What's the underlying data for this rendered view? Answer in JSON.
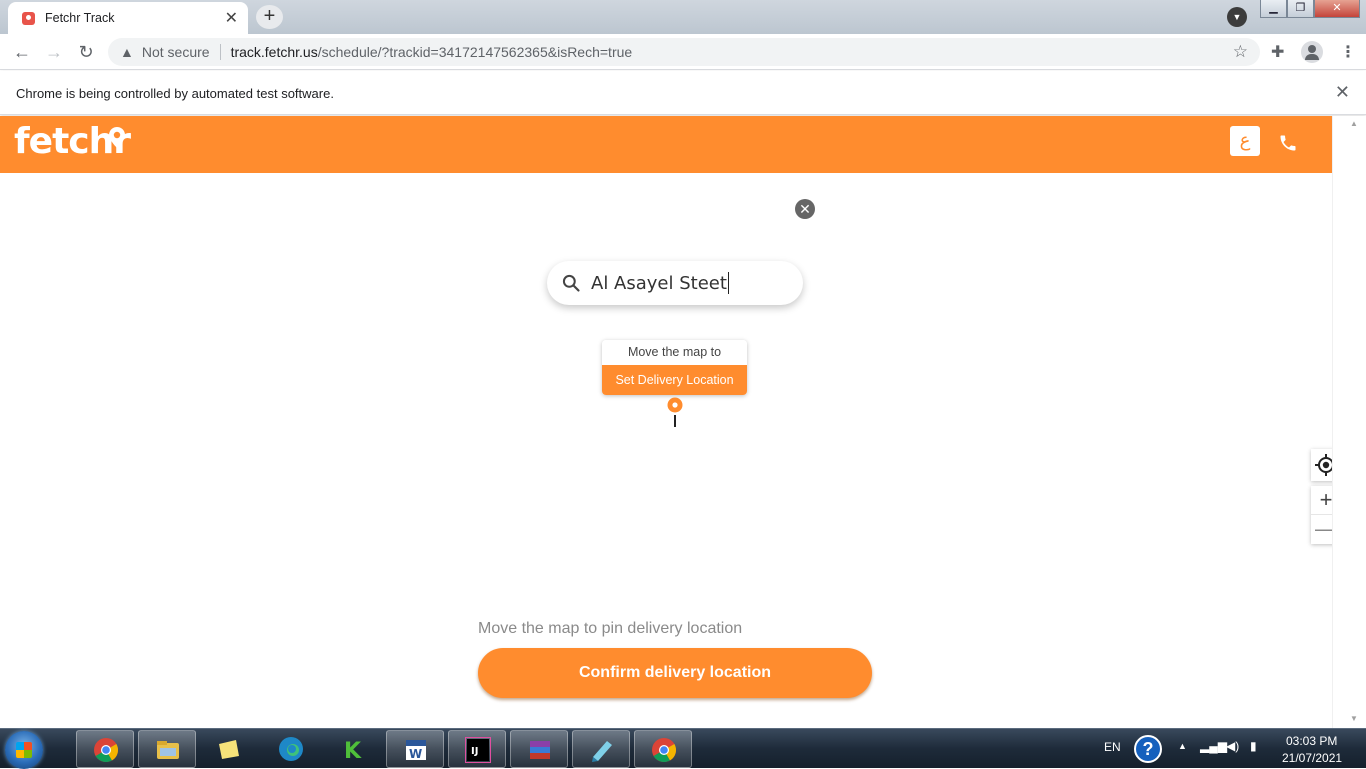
{
  "browser": {
    "tab_title": "Fetchr Track",
    "new_tab": "+",
    "security_label": "Not secure",
    "url_host": "track.fetchr.us",
    "url_path": "/schedule/?trackid=34172147562365&isRech=true",
    "infobar_text": "Chrome is being controlled by automated test software."
  },
  "page": {
    "logo": "fetchr",
    "lang_button": "ع",
    "search": {
      "value": "Al Asayel Steet",
      "clear": "✕"
    },
    "tooltip": {
      "top": "Move the map to",
      "bottom": "Set Delivery Location"
    },
    "zoom_in": "+",
    "zoom_out": "—",
    "hint": "Move the map to pin delivery location",
    "confirm_button": "Confirm delivery location",
    "accent_color": "#ff8c2e"
  },
  "taskbar": {
    "apps": [
      "chrome-icon",
      "file-explorer-icon",
      "sticky-notes-icon",
      "edge-icon",
      "excel-icon",
      "word-icon",
      "intellij-icon",
      "winrar-icon",
      "pen-icon",
      "chrome-icon"
    ],
    "language": "EN",
    "help": "?",
    "time": "03:03 PM",
    "date": "21/07/2021"
  }
}
